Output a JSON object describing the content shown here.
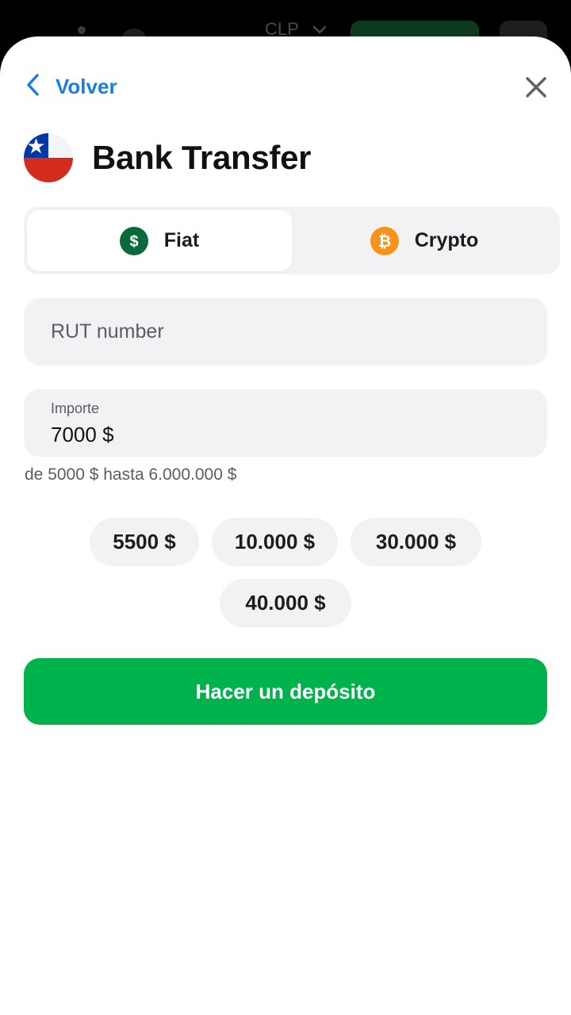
{
  "header": {
    "currency": "CLP",
    "back_label": "Volver",
    "back_icon": "chevron-left-icon",
    "close_icon": "close-icon"
  },
  "method": {
    "title": "Bank Transfer",
    "flag_icon": "chile-flag-icon"
  },
  "tabs": [
    {
      "label": "Fiat",
      "icon": "dollar-icon",
      "active": true
    },
    {
      "label": "Crypto",
      "icon": "bitcoin-icon",
      "active": false
    }
  ],
  "form": {
    "rut_placeholder": "RUT number",
    "amount_label": "Importe",
    "amount_value": "7000 $",
    "range_hint": "de 5000 $ hasta 6.000.000 $"
  },
  "quick_amounts": [
    "5500 $",
    "10.000 $",
    "30.000 $",
    "40.000 $"
  ],
  "submit_label": "Hacer un depósito",
  "colors": {
    "accent_blue": "#1a7ee0",
    "cta_green": "#00b24c",
    "fiat_green": "#0b6a3a",
    "bitcoin_orange": "#f7931a",
    "field_bg": "#f1f2f4"
  }
}
